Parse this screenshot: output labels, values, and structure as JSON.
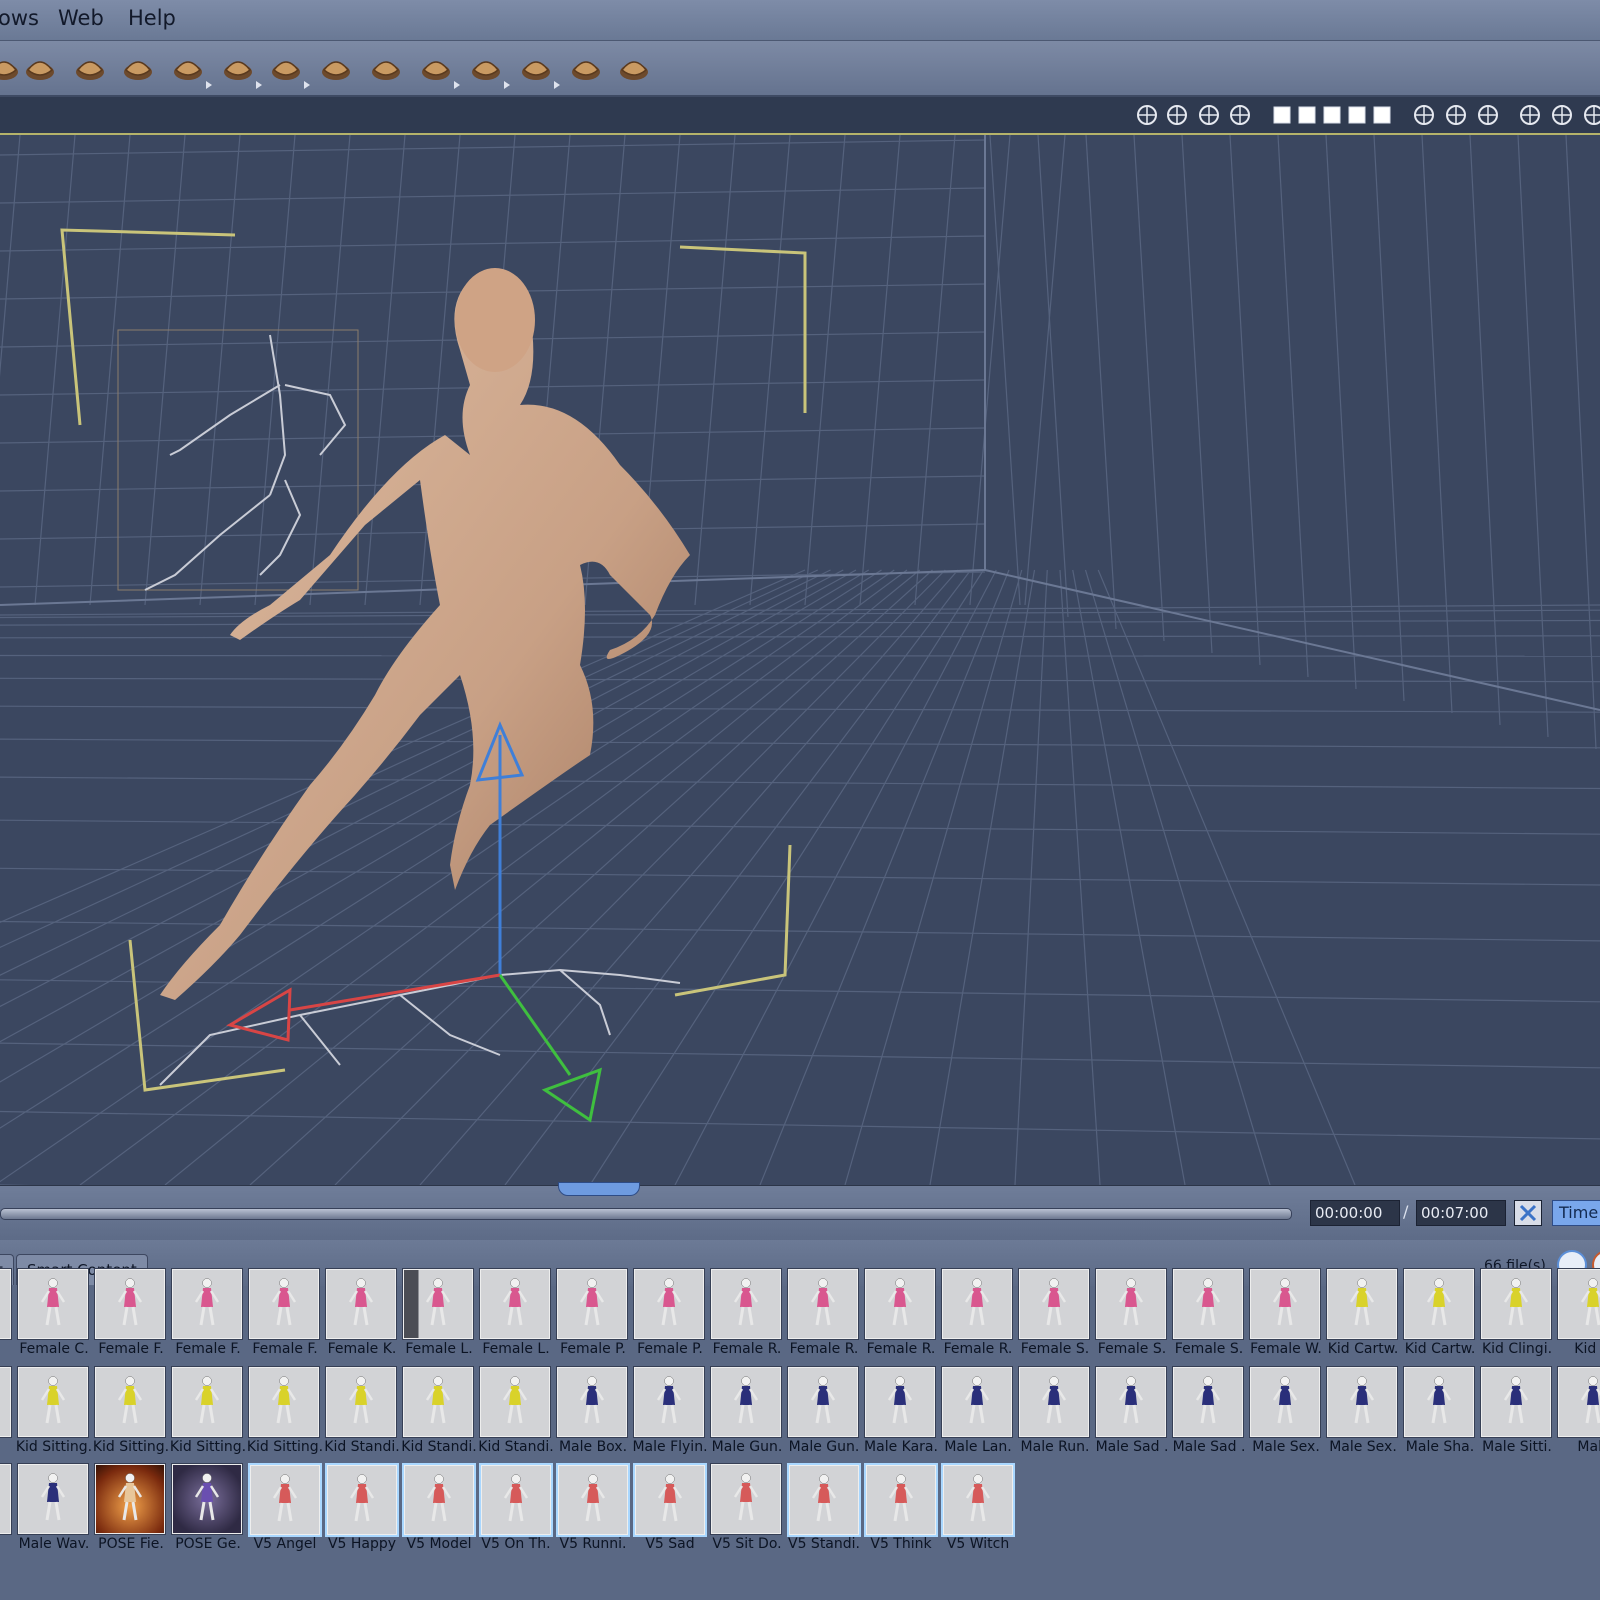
{
  "menu": {
    "items": [
      {
        "label": "ows"
      },
      {
        "label": "Web"
      },
      {
        "label": "Help"
      }
    ]
  },
  "toolbar": {
    "icons": [
      "arrow-icon",
      "cluster-icon",
      "terrain-icon",
      "tree-icon",
      "cloud-icon",
      "flame-icon",
      "rocks-icon",
      "ground-icon",
      "dome-icon",
      "brush-icon",
      "camera-icon",
      "lights-icon",
      "target-icon",
      "bone-icon"
    ]
  },
  "timeline": {
    "current_time": "00:00:00",
    "separator": "/",
    "end_time": "00:07:00",
    "time_tab": "Time"
  },
  "library": {
    "tabs": [
      {
        "label": "t"
      },
      {
        "label": "Smart Content"
      }
    ],
    "file_count": "66 file(s).",
    "rows": [
      [
        {
          "label": "C.",
          "figure": "pink"
        },
        {
          "label": "Female C.",
          "figure": "pink"
        },
        {
          "label": "Female F.",
          "figure": "pink"
        },
        {
          "label": "Female F.",
          "figure": "pink"
        },
        {
          "label": "Female F.",
          "figure": "pink"
        },
        {
          "label": "Female K.",
          "figure": "pink"
        },
        {
          "label": "Female L.",
          "figure": "pink",
          "style": "box"
        },
        {
          "label": "Female L.",
          "figure": "pink"
        },
        {
          "label": "Female P.",
          "figure": "pink"
        },
        {
          "label": "Female P.",
          "figure": "pink"
        },
        {
          "label": "Female R.",
          "figure": "pink"
        },
        {
          "label": "Female R.",
          "figure": "pink"
        },
        {
          "label": "Female R.",
          "figure": "pink"
        },
        {
          "label": "Female R.",
          "figure": "pink"
        },
        {
          "label": "Female S.",
          "figure": "pink"
        },
        {
          "label": "Female S.",
          "figure": "pink"
        },
        {
          "label": "Female S.",
          "figure": "pink"
        },
        {
          "label": "Female W.",
          "figure": "pink"
        },
        {
          "label": "Kid Cartw.",
          "figure": "yellow"
        },
        {
          "label": "Kid Cartw.",
          "figure": "yellow"
        },
        {
          "label": "Kid Clingi.",
          "figure": "yellow"
        },
        {
          "label": "Kid Ju",
          "figure": "yellow"
        }
      ],
      [
        {
          "label": "i.",
          "figure": "yellow"
        },
        {
          "label": "Kid Sitting.",
          "figure": "yellow"
        },
        {
          "label": "Kid Sitting.",
          "figure": "yellow"
        },
        {
          "label": "Kid Sitting.",
          "figure": "yellow"
        },
        {
          "label": "Kid Sitting.",
          "figure": "yellow"
        },
        {
          "label": "Kid Standi.",
          "figure": "yellow"
        },
        {
          "label": "Kid Standi.",
          "figure": "yellow"
        },
        {
          "label": "Kid Standi.",
          "figure": "yellow"
        },
        {
          "label": "Male Box.",
          "figure": "navy"
        },
        {
          "label": "Male Flyin.",
          "figure": "navy"
        },
        {
          "label": "Male Gun.",
          "figure": "navy"
        },
        {
          "label": "Male Gun.",
          "figure": "navy"
        },
        {
          "label": "Male Kara.",
          "figure": "navy"
        },
        {
          "label": "Male Lan.",
          "figure": "navy"
        },
        {
          "label": "Male Run.",
          "figure": "navy"
        },
        {
          "label": "Male Sad .",
          "figure": "navy"
        },
        {
          "label": "Male Sad .",
          "figure": "navy"
        },
        {
          "label": "Male Sex.",
          "figure": "navy"
        },
        {
          "label": "Male Sex.",
          "figure": "navy"
        },
        {
          "label": "Male Sha.",
          "figure": "navy"
        },
        {
          "label": "Male Sitti.",
          "figure": "navy"
        },
        {
          "label": "Male",
          "figure": "navy"
        }
      ],
      [
        {
          "label": "n.",
          "figure": "navy"
        },
        {
          "label": "Male Wav.",
          "figure": "navy"
        },
        {
          "label": "POSE Fie.",
          "figure": "gold",
          "style": "fire"
        },
        {
          "label": "POSE Ge.",
          "figure": "purple",
          "style": "dark"
        },
        {
          "label": "V5 Angel",
          "figure": "red",
          "style": "sel"
        },
        {
          "label": "V5 Happy",
          "figure": "red",
          "style": "sel"
        },
        {
          "label": "V5 Model",
          "figure": "red",
          "style": "sel"
        },
        {
          "label": "V5 On Th.",
          "figure": "red",
          "style": "sel"
        },
        {
          "label": "V5 Runni.",
          "figure": "red",
          "style": "sel"
        },
        {
          "label": "V5 Sad",
          "figure": "red",
          "style": "sel"
        },
        {
          "label": "V5 Sit Do.",
          "figure": "red"
        },
        {
          "label": "V5 Standi.",
          "figure": "red",
          "style": "sel"
        },
        {
          "label": "V5 Think",
          "figure": "red",
          "style": "sel"
        },
        {
          "label": "V5 Witch",
          "figure": "red",
          "style": "sel"
        }
      ]
    ]
  },
  "colors": {
    "pink": "#d9578f",
    "yellow": "#d9d22a",
    "navy": "#2a2f7a",
    "red": "#d65a5a",
    "gold": "#e8c69a",
    "purple": "#6a4fb0",
    "skin": "#c8a085",
    "grid": "#55627d",
    "bracket": "#c9c47a"
  }
}
